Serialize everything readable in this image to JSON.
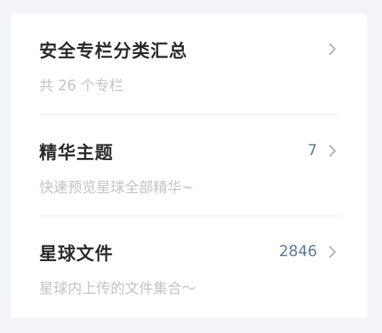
{
  "list": {
    "items": [
      {
        "title": "安全专栏分类汇总",
        "subtitle": "共 26 个专栏",
        "count": "",
        "icon": "chevron-right-icon"
      },
      {
        "title": "精华主题",
        "subtitle": "快速预览星球全部精华~",
        "count": "7",
        "icon": "chevron-right-icon"
      },
      {
        "title": "星球文件",
        "subtitle": "星球内上传的文件集合～",
        "count": "2846",
        "icon": "chevron-right-icon"
      }
    ]
  },
  "colors": {
    "background": "#f3f4f8",
    "card": "#ffffff",
    "title": "#2b2b2b",
    "subtitle": "#c3c3c8",
    "count": "#5b7b9a",
    "chevron": "#b7b7bc",
    "divider": "#ebebeb"
  }
}
